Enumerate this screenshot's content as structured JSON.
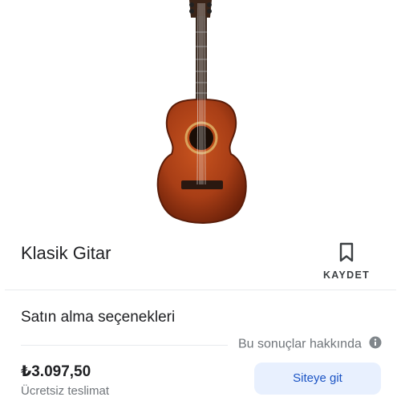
{
  "product": {
    "image_icon": "classical-guitar-image",
    "title": "Klasik Gitar"
  },
  "save": {
    "icon": "bookmark-icon",
    "label": "KAYDET"
  },
  "purchase": {
    "heading": "Satın alma seçenekleri",
    "about_results": "Bu sonuçlar hakkında",
    "about_icon": "info-icon",
    "price": "₺3.097,50",
    "delivery": "Ücretsiz teslimat",
    "visit_button": "Siteye git"
  },
  "colors": {
    "guitar_body": "#a83e16",
    "button_bg": "#e8f0fe",
    "button_text": "#1a53c4",
    "secondary_text": "#70757a"
  }
}
